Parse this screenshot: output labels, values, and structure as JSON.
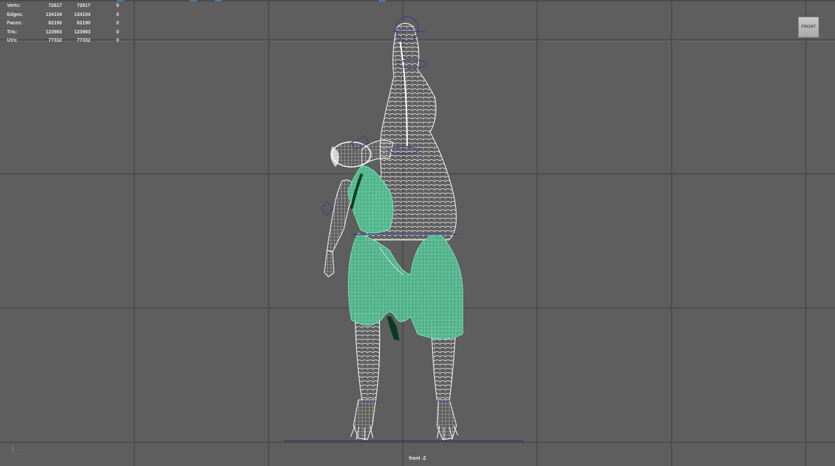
{
  "app": {
    "viewport_name": "front",
    "camera_label": "front -Z",
    "view_cube_label": "FRONT"
  },
  "hud": {
    "rows": [
      {
        "label": "Verts:",
        "v1": "72617",
        "v2": "72617",
        "v3": "0"
      },
      {
        "label": "Edges:",
        "v1": "134104",
        "v2": "134104",
        "v3": "0"
      },
      {
        "label": "Faces:",
        "v1": "62190",
        "v2": "62190",
        "v3": "0"
      },
      {
        "label": "Tris:",
        "v1": "123983",
        "v2": "123983",
        "v3": "0"
      },
      {
        "label": "UVs:",
        "v1": "77332",
        "v2": "77332",
        "v3": "0"
      }
    ]
  },
  "axis": {
    "y_label": "y",
    "x_label": "x"
  },
  "colors": {
    "background": "#5e5e5e",
    "grid_line": "#3e3e3e",
    "wireframe": "#ffffff",
    "selected_mesh": "#5fd6a4",
    "selected_dark": "#0b3a22",
    "controller": "#3b3f8f"
  },
  "scene": {
    "object": "character wireframe mesh",
    "selection": "cloth garment (green)",
    "icons": [
      "view-cube-icon",
      "axis-gizmo-icon"
    ]
  }
}
